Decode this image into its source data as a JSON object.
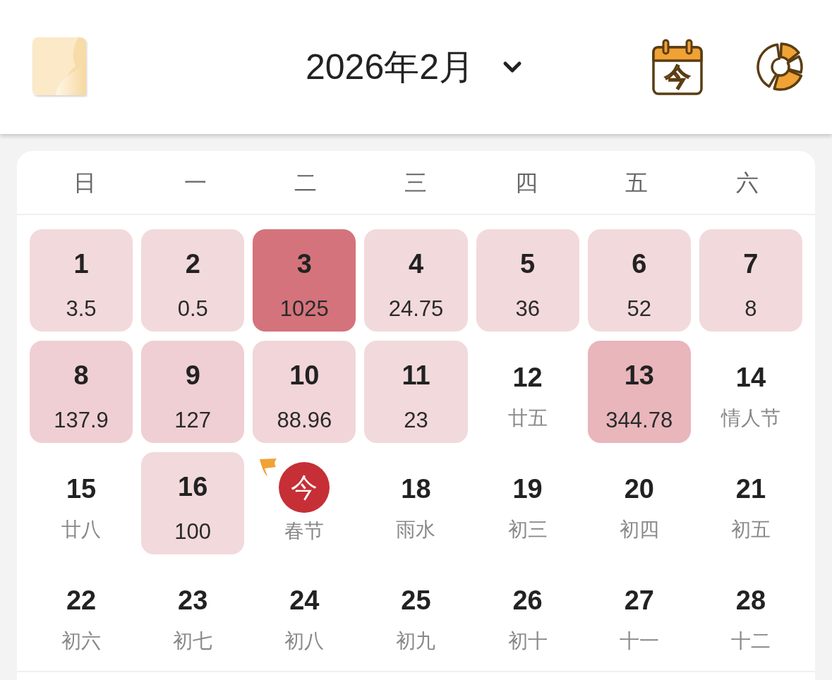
{
  "header": {
    "title": "2026年2月",
    "today_button": {
      "label": "今"
    }
  },
  "weekdays": [
    "日",
    "一",
    "二",
    "三",
    "四",
    "五",
    "六"
  ],
  "days": [
    {
      "kind": "amount",
      "day": "1",
      "amount": "3.5",
      "color": "#f2d9dc",
      "flagged": false
    },
    {
      "kind": "amount",
      "day": "2",
      "amount": "0.5",
      "color": "#f2d9dc",
      "flagged": false
    },
    {
      "kind": "amount",
      "day": "3",
      "amount": "1025",
      "color": "#d4737c",
      "flagged": false
    },
    {
      "kind": "amount",
      "day": "4",
      "amount": "24.75",
      "color": "#f2d9dc",
      "flagged": false
    },
    {
      "kind": "amount",
      "day": "5",
      "amount": "36",
      "color": "#f2d9dc",
      "flagged": false
    },
    {
      "kind": "amount",
      "day": "6",
      "amount": "52",
      "color": "#f2d9dc",
      "flagged": false
    },
    {
      "kind": "amount",
      "day": "7",
      "amount": "8",
      "color": "#f2d9dc",
      "flagged": false
    },
    {
      "kind": "amount",
      "day": "8",
      "amount": "137.9",
      "color": "#efcfd3",
      "flagged": false
    },
    {
      "kind": "amount",
      "day": "9",
      "amount": "127",
      "color": "#efcfd3",
      "flagged": false
    },
    {
      "kind": "amount",
      "day": "10",
      "amount": "88.96",
      "color": "#f1d5d9",
      "flagged": false
    },
    {
      "kind": "amount",
      "day": "11",
      "amount": "23",
      "color": "#f2d9dc",
      "flagged": false
    },
    {
      "kind": "lunar",
      "day": "12",
      "lunar": "廿五",
      "flagged": false
    },
    {
      "kind": "amount",
      "day": "13",
      "amount": "344.78",
      "color": "#e8b6bb",
      "flagged": false
    },
    {
      "kind": "lunar",
      "day": "14",
      "lunar": "情人节",
      "flagged": false
    },
    {
      "kind": "lunar",
      "day": "15",
      "lunar": "廿八",
      "flagged": false
    },
    {
      "kind": "amount",
      "day": "16",
      "amount": "100",
      "color": "#f2d9dc",
      "flagged": false
    },
    {
      "kind": "today",
      "badge": "今",
      "lunar": "春节",
      "flagged": true
    },
    {
      "kind": "lunar",
      "day": "18",
      "lunar": "雨水",
      "flagged": false
    },
    {
      "kind": "lunar",
      "day": "19",
      "lunar": "初三",
      "flagged": false
    },
    {
      "kind": "lunar",
      "day": "20",
      "lunar": "初四",
      "flagged": false
    },
    {
      "kind": "lunar",
      "day": "21",
      "lunar": "初五",
      "flagged": false
    },
    {
      "kind": "lunar",
      "day": "22",
      "lunar": "初六",
      "flagged": false
    },
    {
      "kind": "lunar",
      "day": "23",
      "lunar": "初七",
      "flagged": false
    },
    {
      "kind": "lunar",
      "day": "24",
      "lunar": "初八",
      "flagged": false
    },
    {
      "kind": "lunar",
      "day": "25",
      "lunar": "初九",
      "flagged": false
    },
    {
      "kind": "lunar",
      "day": "26",
      "lunar": "初十",
      "flagged": false
    },
    {
      "kind": "lunar",
      "day": "27",
      "lunar": "十一",
      "flagged": false
    },
    {
      "kind": "lunar",
      "day": "28",
      "lunar": "十二",
      "flagged": false
    }
  ]
}
